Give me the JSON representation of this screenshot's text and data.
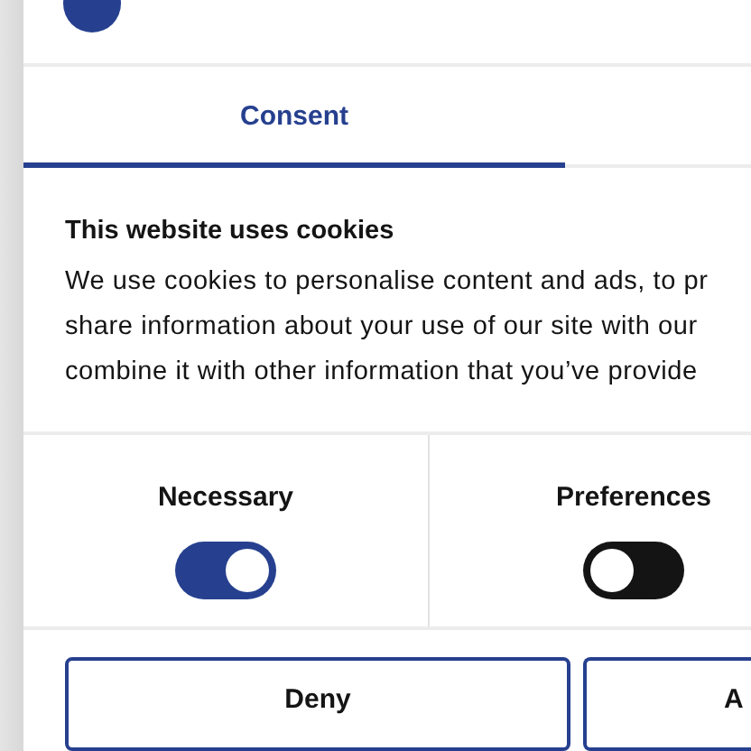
{
  "tabs": [
    {
      "label": "Consent",
      "selected": true
    }
  ],
  "heading": "This website uses cookies",
  "body_lines": [
    "We use cookies to personalise content and ads, to pr",
    "share information about your use of our site with our",
    "combine it with other information that you’ve provide"
  ],
  "toggles": [
    {
      "label": "Necessary",
      "on": true
    },
    {
      "label": "Preferences",
      "on": false
    }
  ],
  "buttons": [
    {
      "label": "Deny"
    },
    {
      "label": "A"
    }
  ]
}
